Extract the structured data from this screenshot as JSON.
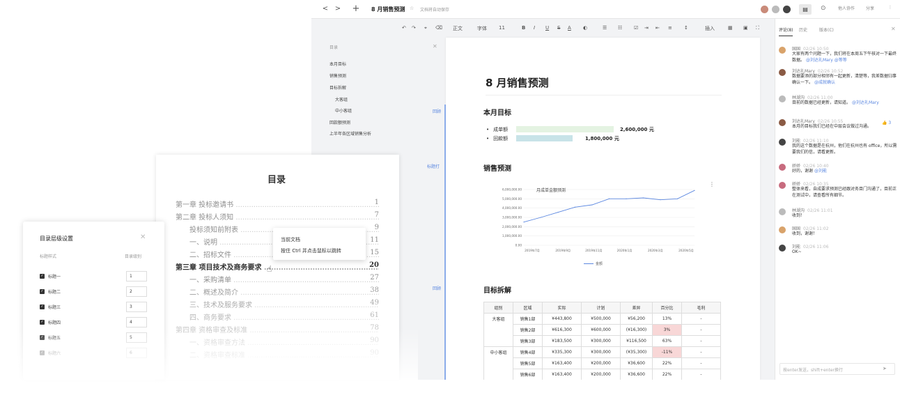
{
  "titlebar": {
    "back": "<",
    "forward": ">",
    "new": "+",
    "doc_title": "8 月销售预测",
    "autosave": "文档将自动保存",
    "btn_add": "他人协作",
    "btn_share": "分享",
    "btn_more": "⋮"
  },
  "toolbar": {
    "items": [
      "正文",
      "字体",
      "11",
      "B",
      "I",
      "U",
      "S",
      "A",
      "插入"
    ]
  },
  "outline": {
    "header": "目录",
    "items": [
      "本月目标",
      "销售预测",
      "目标拆解",
      "大客组",
      "中小客组",
      "回款额预测",
      "上半年各区域销售分析"
    ]
  },
  "document": {
    "title": "8 月销售预测",
    "section1": "本月目标",
    "goals": [
      {
        "label": "成单额",
        "value": "2,600,000 元",
        "fraction": 0.55
      },
      {
        "label": "回款额",
        "value": "1,800,000 元",
        "fraction": 0.3
      }
    ],
    "section2": "销售预测",
    "section3": "目标拆解",
    "markers": [
      "回顾",
      "标题打",
      "回顾"
    ],
    "table": {
      "headers": [
        "组别",
        "区域",
        "实际",
        "计划",
        "差异",
        "百分比",
        "毛利"
      ],
      "rows": [
        [
          "大客组",
          "销售1部",
          "¥443,800",
          "¥500,000",
          "¥56,200",
          "13%",
          "-"
        ],
        [
          "",
          "销售2部",
          "¥616,300",
          "¥600,000",
          "(¥16,300)",
          "3%",
          "-"
        ],
        [
          "",
          "销售3部",
          "¥183,500",
          "¥300,000",
          "¥116,500",
          "63%",
          "-"
        ],
        [
          "中小客组",
          "销售4部",
          "¥335,300",
          "¥300,000",
          "(¥35,300)",
          "-11%",
          "-"
        ],
        [
          "",
          "销售5部",
          "¥163,400",
          "¥200,000",
          "¥36,600",
          "22%",
          "-"
        ],
        [
          "",
          "销售6部",
          "¥163,400",
          "¥200,000",
          "¥36,600",
          "22%",
          "-"
        ]
      ]
    }
  },
  "chart_data": {
    "type": "line",
    "title": "月成单金额预测",
    "x": [
      "2019年7月",
      "2019年9月",
      "2019年11月",
      "2020年1月",
      "2020年3月",
      "2020年5月"
    ],
    "series": [
      {
        "name": "金额",
        "values": [
          2500000,
          3000000,
          3550000,
          4100000,
          4350000,
          5000000,
          5000000,
          5100000,
          4900000,
          5000000,
          5900000
        ]
      }
    ],
    "y_ticks": [
      "6,000,000.00",
      "5,000,000.00",
      "4,000,000.00",
      "3,000,000.00",
      "2,000,000.00",
      "1,000,000.00",
      "0.00"
    ],
    "ylim": [
      0,
      6000000
    ],
    "grid": true,
    "legend": "bottom",
    "line_color": "#5b87e0"
  },
  "comments": {
    "tabs": [
      "评论(8)",
      "历史",
      "版本(C)"
    ],
    "list": [
      {
        "name": "国国",
        "time": "02/26 10:50",
        "text": "大家有两个问题一下，我们将在本周五下午核对一下最终数据。",
        "mention": "@刘达礼Mary @等等"
      },
      {
        "name": "刘达礼Mary",
        "time": "02/26 10:52",
        "text": "数据要添的部分相邻有一起更新，清楚等，我差数据归事确认一下。",
        "mention": "@成就确认"
      },
      {
        "name": "林湖沟",
        "time": "02/26 11:00",
        "text": "目前的数据已经更新，请知道。",
        "mention": "@刘达礼Mary"
      },
      {
        "name": "刘达礼Mary",
        "time": "02/26 10:55",
        "text": "本月的目标我们已经在中层会议做过沟通。",
        "mention": ""
      },
      {
        "name": "刘能",
        "time": "02/26 11:10",
        "text": "我的这个数据是在杭州，他们在杭州也有 office，所以需要我们的信，请看更新。",
        "mention": ""
      },
      {
        "name": "娇娇",
        "time": "02/26 10:40",
        "text": "好的，谢谢",
        "mention": "@刘能"
      },
      {
        "name": "娇娇",
        "time": "02/26 10:35",
        "text": "整体来看，自成要求预测已经跟对务目门沟通了，目前正在测试中，请查看所有细节。",
        "mention": ""
      },
      {
        "name": "林湖沟",
        "time": "02/26 11:01",
        "text": "收到！",
        "mention": ""
      },
      {
        "name": "国国",
        "time": "02/26 11:02",
        "text": "收到，谢谢！",
        "mention": ""
      },
      {
        "name": "刘能",
        "time": "02/26 11:06",
        "text": "OK~",
        "mention": ""
      }
    ],
    "input_placeholder": "按enter发送，shift+enter换行"
  },
  "toc": {
    "title": "目录",
    "lines": [
      {
        "text": "第一章  投标邀请书",
        "page": "1",
        "bold": false,
        "indent": 0
      },
      {
        "text": "第二章  投标人须知",
        "page": "7",
        "bold": false,
        "indent": 0
      },
      {
        "text": "投标须知前附表",
        "page": "9",
        "bold": false,
        "indent": 1
      },
      {
        "text": "一、说明",
        "page": "11",
        "bold": false,
        "indent": 1
      },
      {
        "text": "二、招标文件",
        "page": "15",
        "bold": false,
        "indent": 1
      },
      {
        "text": "第三章  项目技术及商务要求",
        "page": "20",
        "bold": true,
        "indent": 0
      },
      {
        "text": "一、采购清单",
        "page": "27",
        "bold": false,
        "indent": 1
      },
      {
        "text": "二、概述及简介",
        "page": "38",
        "bold": false,
        "indent": 1
      },
      {
        "text": "三、技术及服务要求",
        "page": "49",
        "bold": false,
        "indent": 1
      },
      {
        "text": "四、商务要求",
        "page": "61",
        "bold": false,
        "indent": 1
      },
      {
        "text": "第四章  资格审查及标准",
        "page": "78",
        "bold": false,
        "indent": 0
      },
      {
        "text": "一、资格审查方法",
        "page": "90",
        "bold": false,
        "indent": 1
      },
      {
        "text": "二、资格审查标准",
        "page": "90",
        "bold": false,
        "indent": 1
      }
    ]
  },
  "tooltip": {
    "line1": "当前文档",
    "line2": "按住 Ctrl 并点击鼠标以跳转"
  },
  "dialog": {
    "title": "目录层级设置",
    "close": "✕",
    "col1": "标题样式",
    "col2": "目录级别",
    "rows": [
      {
        "label": "标题一",
        "level": "1"
      },
      {
        "label": "标题二",
        "level": "2"
      },
      {
        "label": "标题三",
        "level": "3"
      },
      {
        "label": "标题四",
        "level": "4"
      },
      {
        "label": "标题五",
        "level": "5"
      },
      {
        "label": "标题六",
        "level": "6"
      }
    ]
  }
}
